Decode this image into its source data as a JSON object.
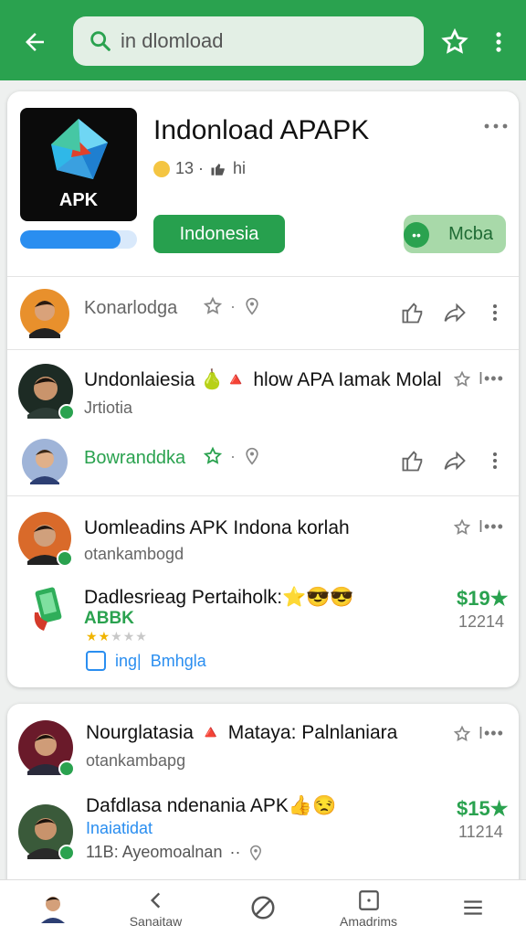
{
  "search": {
    "value": "in dlomload",
    "placeholder": ""
  },
  "app": {
    "title": "Indonload APAPK",
    "icon_label": "APK",
    "meta": "13 ·",
    "meta_suffix": "hi",
    "progress_fraction": 0.86,
    "install_label": "Indonesia",
    "secondary_label": "Mcba"
  },
  "rows": [
    {
      "name": "Konarlodga",
      "sub": ""
    },
    {
      "name": "Undonlaiesia 🍐🔺 hlow APA Iamak Molal",
      "sub": "Jrtiotia"
    },
    {
      "name": "Bowranddka",
      "sub": ""
    },
    {
      "name": "Uomleadins APK Indona korlah",
      "sub": "otankambogd"
    }
  ],
  "product1": {
    "title": "Dadlesrieag Pertaiholk:⭐😎😎",
    "subtitle": "ABBK",
    "rating": 2,
    "price": "$19★",
    "count": "12214",
    "tag1": "ing|",
    "tag2": "Bmhgla"
  },
  "card2": {
    "row1_name": "Nourglatasia 🔺 Mataya: Palnlaniara",
    "row1_sub": "otankambapg",
    "row2_name": "Dafdlasa ndenania APK👍😒",
    "row2_sub": "Inaiatidat",
    "row2_meta": "11B: Ayeomoalnan",
    "price": "$15★",
    "count": "11214"
  },
  "nav": [
    {
      "label": ""
    },
    {
      "label": "Sanaitaw"
    },
    {
      "label": ""
    },
    {
      "label": "Amadrims"
    },
    {
      "label": ""
    }
  ],
  "colors": {
    "brand": "#2aa24f",
    "accent": "#2a8ef0",
    "star": "#f0b400"
  }
}
